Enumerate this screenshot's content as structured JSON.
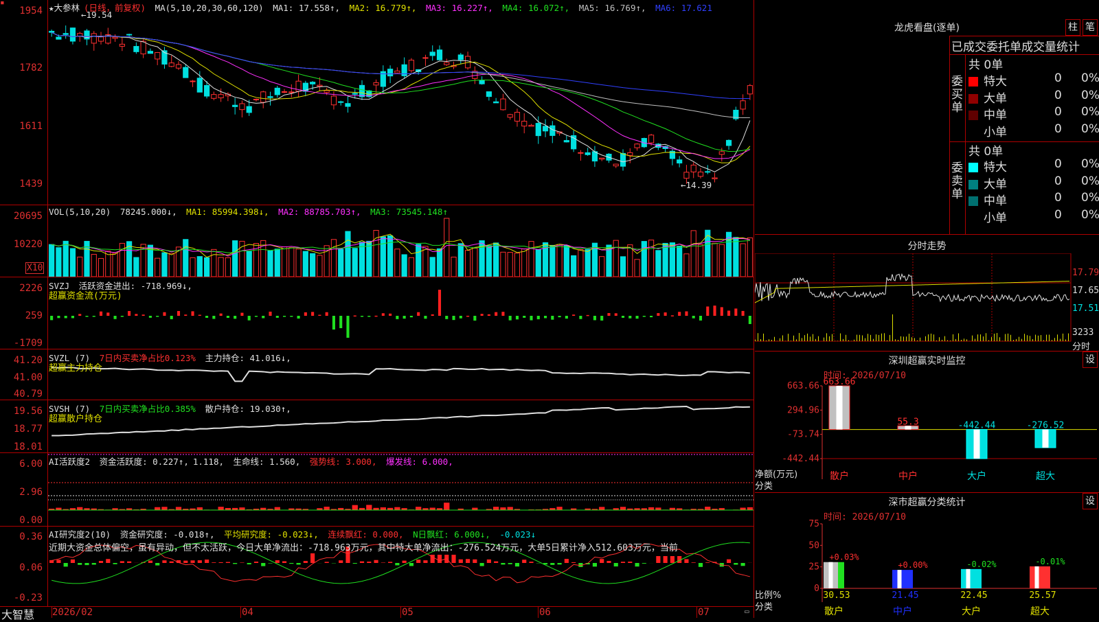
{
  "main": {
    "ticker_title": "★大参林",
    "period_note": "(日线，前复权)",
    "ma_header": "MA(5,10,20,30,60,120)",
    "ma_values": [
      {
        "label": "MA1: 17.558↑,",
        "color": "#e0e0e0"
      },
      {
        "label": "MA2: 16.779↑,",
        "color": "#e0e000"
      },
      {
        "label": "MA3: 16.227↑,",
        "color": "#ff30ff"
      },
      {
        "label": "MA4: 16.072↑,",
        "color": "#20e020"
      },
      {
        "label": "MA5: 16.769↑,",
        "color": "#c0c0c0"
      },
      {
        "label": "MA6: 17.621",
        "color": "#3040ff"
      }
    ],
    "y_ticks": [
      "1954",
      "1782",
      "1611",
      "1439"
    ],
    "high_marker": "←19.54",
    "low_marker": "←14.39"
  },
  "vol": {
    "header": "VOL(5,10,20)",
    "value": "78245.000↓,",
    "ma1": "MA1: 85994.398↓,",
    "ma2": "MA2: 88785.703↑,",
    "ma3": "MA3: 73545.148↑",
    "y_ticks": [
      "20695",
      "10220"
    ],
    "unit": "X10"
  },
  "svzj": {
    "header": "SVZJ",
    "desc": "活跃资金进出: -718.969↓,",
    "title": "超赢资金流(万元)",
    "y_ticks": [
      "2226",
      "259",
      "-1709"
    ]
  },
  "svzl": {
    "header": "SVZL (7)",
    "ratio": "7日内买卖净占比0.123%",
    "hold": "主力持仓: 41.016↓,",
    "title": "超赢主力持仓",
    "y_ticks": [
      "41.20",
      "41.00",
      "40.79"
    ]
  },
  "svsh": {
    "header": "SVSH (7)",
    "ratio": "7日内买卖净占比0.385%",
    "hold": "散户持仓: 19.030↑,",
    "title": "超赢散户持仓",
    "y_ticks": [
      "19.56",
      "18.77",
      "18.01"
    ]
  },
  "ai1": {
    "header": "AI活跃度2",
    "a": "资金活跃度: 0.227↑,",
    "b": "1.118,",
    "c": "生命线: 1.560,",
    "d": "强势线: 3.000,",
    "e": "爆发线: 6.000,",
    "y_ticks": [
      "6.00",
      "2.96",
      "0.00"
    ]
  },
  "ai2": {
    "header": "AI研究度2(10)",
    "a": "资金研究度: -0.018↑,",
    "b": "平均研究度: -0.023↓,",
    "c": "连续飘红: 0.000,",
    "d": "N日飘红: 6.000↓,",
    "e": "-0.023↓",
    "note": "近期大资金总体偏空，虽有异动，但不太活跃，今日大单净流出：-718.963万元，其中特大单净流出：-276.524万元，大单5日累计净入512.603万元，当前",
    "y_ticks": [
      "0.36",
      "0.06",
      "-0.23"
    ]
  },
  "xaxis": [
    "2026/02",
    "04",
    "05",
    "06",
    "07"
  ],
  "brand": "大智慧",
  "right": {
    "dragon_title": "龙虎看盘(逐单)",
    "btn_bar": "柱",
    "btn_pen": "笔",
    "stats_header": "已成交委托单成交量统计",
    "buy_label": "委买单",
    "sell_label": "委卖单",
    "buy_total": "共 0单",
    "sell_total": "共 0单",
    "buy_rows": [
      {
        "name": "特大",
        "count": "0",
        "pct": "0%",
        "color": "#ff0000"
      },
      {
        "name": "大单",
        "count": "0",
        "pct": "0%",
        "color": "#900000"
      },
      {
        "name": "中单",
        "count": "0",
        "pct": "0%",
        "color": "#600000"
      },
      {
        "name": "小单",
        "count": "0",
        "pct": "0%",
        "color": ""
      }
    ],
    "sell_rows": [
      {
        "name": "特大",
        "count": "0",
        "pct": "0%",
        "color": "#00ffff"
      },
      {
        "name": "大单",
        "count": "0",
        "pct": "0%",
        "color": "#008080"
      },
      {
        "name": "中单",
        "count": "0",
        "pct": "0%",
        "color": "#007070"
      },
      {
        "name": "小单",
        "count": "0",
        "pct": "0%",
        "color": ""
      }
    ],
    "intraday_title": "分时走势",
    "intraday_ticks": [
      "17.79",
      "17.65",
      "17.51"
    ],
    "intraday_vol": "3233",
    "intraday_unit": "分时",
    "monitor_title": "深圳超赢实时监控",
    "monitor_btn": "设",
    "monitor_time": "时间: 2026/07/10",
    "monitor_ticks": [
      "663.66",
      "294.96",
      "-73.74",
      "-442.44"
    ],
    "monitor_ylabel": "净额(万元)",
    "monitor_xlabel": "分类",
    "monitor_cats": [
      "散户",
      "中户",
      "大户",
      "超大"
    ],
    "monitor_vals_text": [
      "663.66",
      "55.3",
      "-442.44",
      "-276.52"
    ],
    "class_title": "深市超赢分类统计",
    "class_btn": "设",
    "class_time": "时间: 2026/07/10",
    "class_ticks": [
      "75",
      "50",
      "25",
      "0"
    ],
    "class_ylabel": "比例%",
    "class_xlabel": "分类",
    "class_cats": [
      "散户",
      "中户",
      "大户",
      "超大"
    ],
    "class_top": [
      "+0.03%",
      "+0.00%",
      "-0.02%",
      "-0.01%"
    ],
    "class_bottom": [
      "30.53",
      "21.45",
      "22.45",
      "25.57"
    ]
  },
  "chart_data": [
    {
      "type": "bar",
      "title": "深圳超赢实时监控",
      "ylabel": "净额(万元)",
      "categories": [
        "散户",
        "中户",
        "大户",
        "超大"
      ],
      "values": [
        663.66,
        55.3,
        -442.44,
        -276.52
      ],
      "ylim": [
        -442.44,
        663.66
      ]
    },
    {
      "type": "bar",
      "title": "深市超赢分类统计",
      "ylabel": "比例%",
      "categories": [
        "散户",
        "中户",
        "大户",
        "超大"
      ],
      "values": [
        30.53,
        21.45,
        22.45,
        25.57
      ],
      "ylim": [
        0,
        75
      ]
    }
  ]
}
